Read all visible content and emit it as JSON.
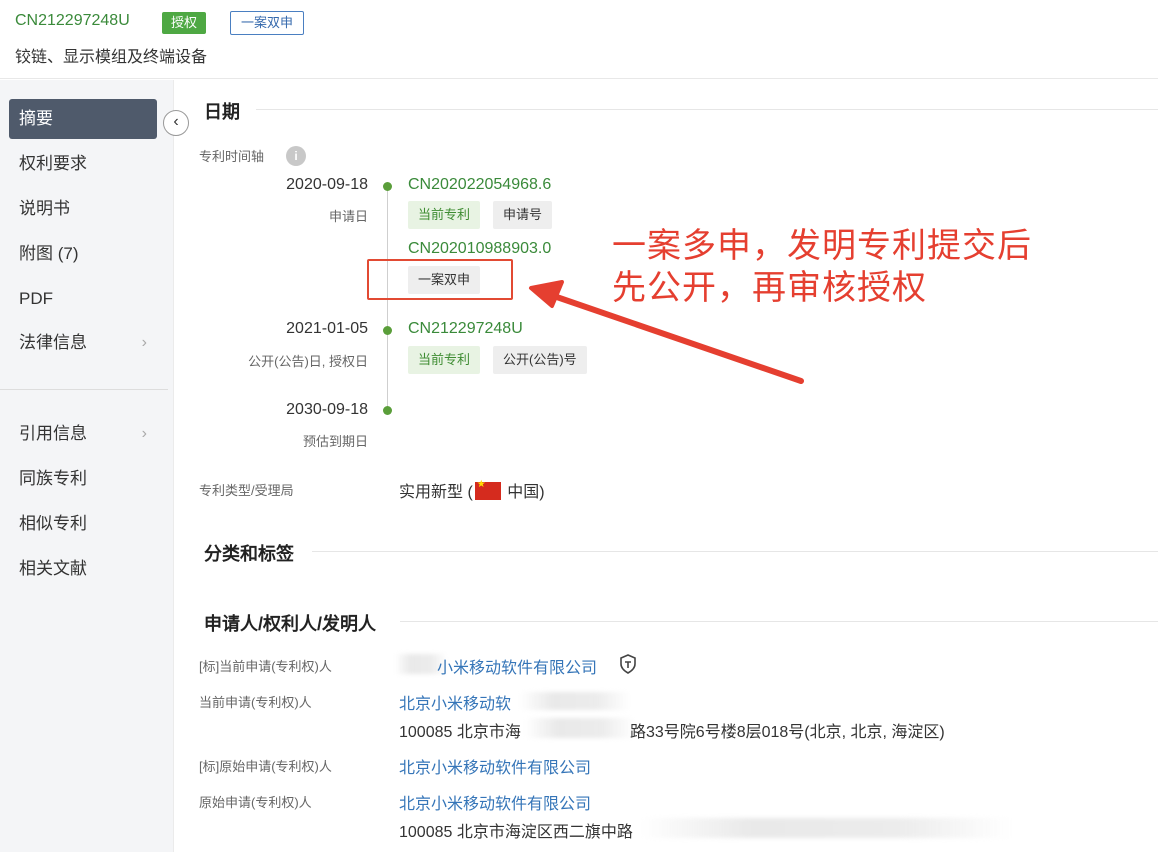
{
  "header": {
    "patent_number": "CN212297248U",
    "status_badge": "授权",
    "dual_badge": "一案双申",
    "title": "铰链、显示模组及终端设备"
  },
  "sidebar": {
    "collapse_icon": "‹",
    "items": [
      {
        "label": "摘要",
        "active": true
      },
      {
        "label": "权利要求"
      },
      {
        "label": "说明书"
      },
      {
        "label": "附图 (7)"
      },
      {
        "label": "PDF"
      },
      {
        "label": "法律信息",
        "chevron": "›"
      },
      {
        "label": "引用信息",
        "chevron": "›"
      },
      {
        "label": "同族专利"
      },
      {
        "label": "相似专利"
      },
      {
        "label": "相关文献"
      }
    ]
  },
  "sections": {
    "dates": "日期",
    "classification": "分类和标签",
    "applicants": "申请人/权利人/发明人"
  },
  "timeline": {
    "label": "专利时间轴",
    "info_icon": "i",
    "entries": [
      {
        "date": "2020-09-18",
        "sub": "申请日",
        "number": "CN202022054968.6",
        "tags": [
          "当前专利",
          "申请号"
        ]
      },
      {
        "number": "CN202010988903.0",
        "tags": [
          "一案双申"
        ]
      },
      {
        "date": "2021-01-05",
        "sub": "公开(公告)日, 授权日",
        "number": "CN212297248U",
        "tags": [
          "当前专利",
          "公开(公告)号"
        ]
      },
      {
        "date": "2030-09-18",
        "sub": "预估到期日"
      }
    ]
  },
  "patent_type": {
    "label": "专利类型/受理局",
    "value_prefix": "实用新型 (",
    "value_suffix": " 中国)"
  },
  "applicants": [
    {
      "label": "[标]当前申请(专利权)人",
      "value": "小米移动软件有限公司"
    },
    {
      "label": "当前申请(专利权)人",
      "value": "北京小米移动软",
      "address_a": "100085 北京市海",
      "address_b": "路33号院6号楼8层018号(北京, 北京, 海淀区)"
    },
    {
      "label": "[标]原始申请(专利权)人",
      "value": "北京小米移动软件有限公司"
    },
    {
      "label": "原始申请(专利权)人",
      "value": "北京小米移动软件有限公司",
      "address": "100085 北京市海淀区西二旗中路"
    }
  ],
  "annotation": {
    "line1": "一案多申，发明专利提交后",
    "line2": "先公开，再审核授权",
    "color": "#e53f30"
  },
  "colors": {
    "accent_green": "#4ea843",
    "link_blue": "#3575b8",
    "sidebar_active": "#4f5a6b"
  }
}
